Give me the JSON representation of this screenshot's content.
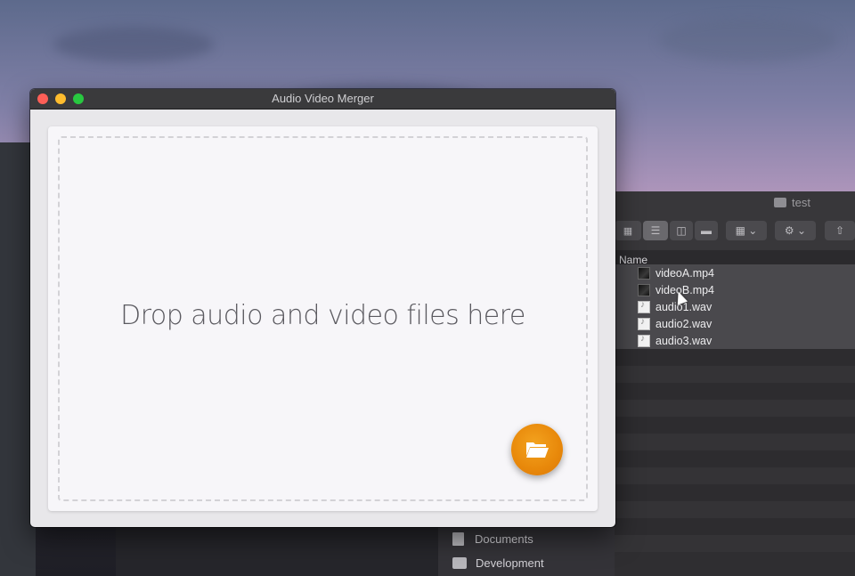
{
  "app_window": {
    "title": "Audio Video Merger",
    "drop_prompt": "Drop audio and video files here",
    "open_button_icon": "folder-open-icon",
    "accent_color": "#ea8a0b"
  },
  "finder": {
    "title": "test",
    "column_header": "Name",
    "files": [
      {
        "name": "videoA.mp4",
        "type": "video"
      },
      {
        "name": "videoB.mp4",
        "type": "video"
      },
      {
        "name": "audio1.wav",
        "type": "audio"
      },
      {
        "name": "audio2.wav",
        "type": "audio"
      },
      {
        "name": "audio3.wav",
        "type": "audio"
      }
    ],
    "sidebar": [
      {
        "label": "Documents",
        "icon": "document-icon"
      },
      {
        "label": "Development",
        "icon": "folder-icon"
      }
    ]
  }
}
